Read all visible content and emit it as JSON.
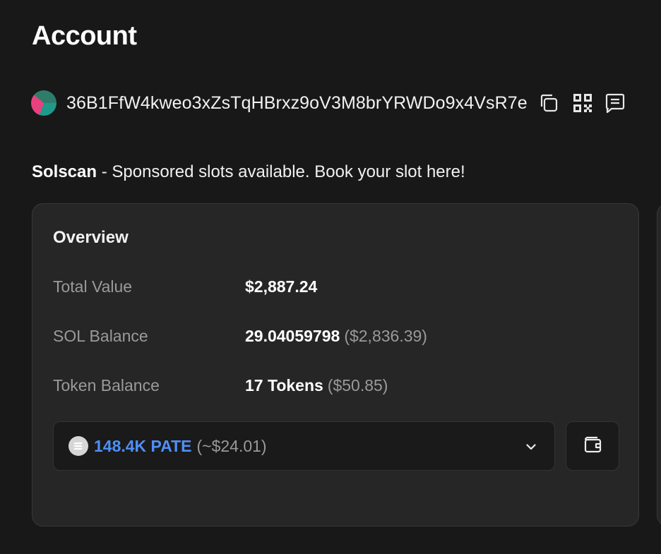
{
  "page": {
    "title": "Account"
  },
  "account": {
    "address": "36B1FfW4kweo3xZsTqHBrxz9oV3M8brYRWDo9x4VsR7e",
    "avatar_colors": [
      "#e8417f",
      "#2e7d6b",
      "#1d9a8a"
    ],
    "actions": {
      "copy_icon": "copy-icon",
      "qr_icon": "qr-code-icon",
      "note_icon": "note-icon"
    }
  },
  "sponsor": {
    "brand": "Solscan",
    "text": " - Sponsored slots available. Book your slot here!"
  },
  "overview": {
    "title": "Overview",
    "total_value": {
      "label": "Total Value",
      "value": "$2,887.24"
    },
    "sol_balance": {
      "label": "SOL Balance",
      "value": "29.04059798",
      "usd": "($2,836.39)"
    },
    "token_balance": {
      "label": "Token Balance",
      "value": "17 Tokens",
      "usd": "($50.85)"
    },
    "token_select": {
      "amount": "148.4K PATE",
      "usd": "(~$24.01)",
      "amount_color": "#4f8ff7"
    },
    "wallet_icon": "wallet-icon"
  }
}
